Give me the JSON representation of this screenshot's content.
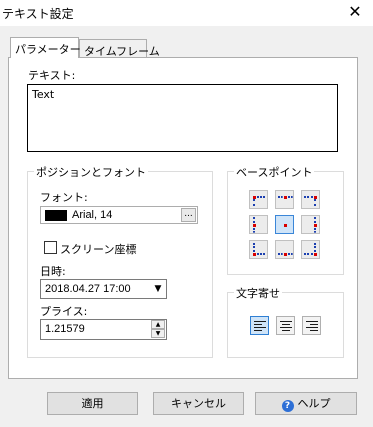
{
  "window": {
    "title": "テキスト設定",
    "close_glyph": "✕"
  },
  "tabs": [
    {
      "label": "パラメーター",
      "active": true
    },
    {
      "label": "タイムフレーム",
      "active": false
    }
  ],
  "text_section": {
    "label": "テキスト:",
    "value": "Text"
  },
  "position_font": {
    "group_label": "ポジションとフォント",
    "font_label": "フォント:",
    "font_value": "Arial, 14",
    "font_color": "#000000",
    "font_more_label": "...",
    "screen_coords_label": "スクリーン座標",
    "screen_coords_checked": false,
    "datetime_label": "日時:",
    "datetime_value": "2018.04.27 17:00",
    "price_label": "プライス:",
    "price_value": "1.21579"
  },
  "base_point": {
    "group_label": "ベースポイント",
    "selected": "center",
    "accent": "#d80000"
  },
  "text_align": {
    "group_label": "文字寄せ",
    "selected": "left"
  },
  "buttons": {
    "apply": "適用",
    "cancel": "キャンセル",
    "help": "ヘルプ",
    "help_glyph": "?"
  }
}
